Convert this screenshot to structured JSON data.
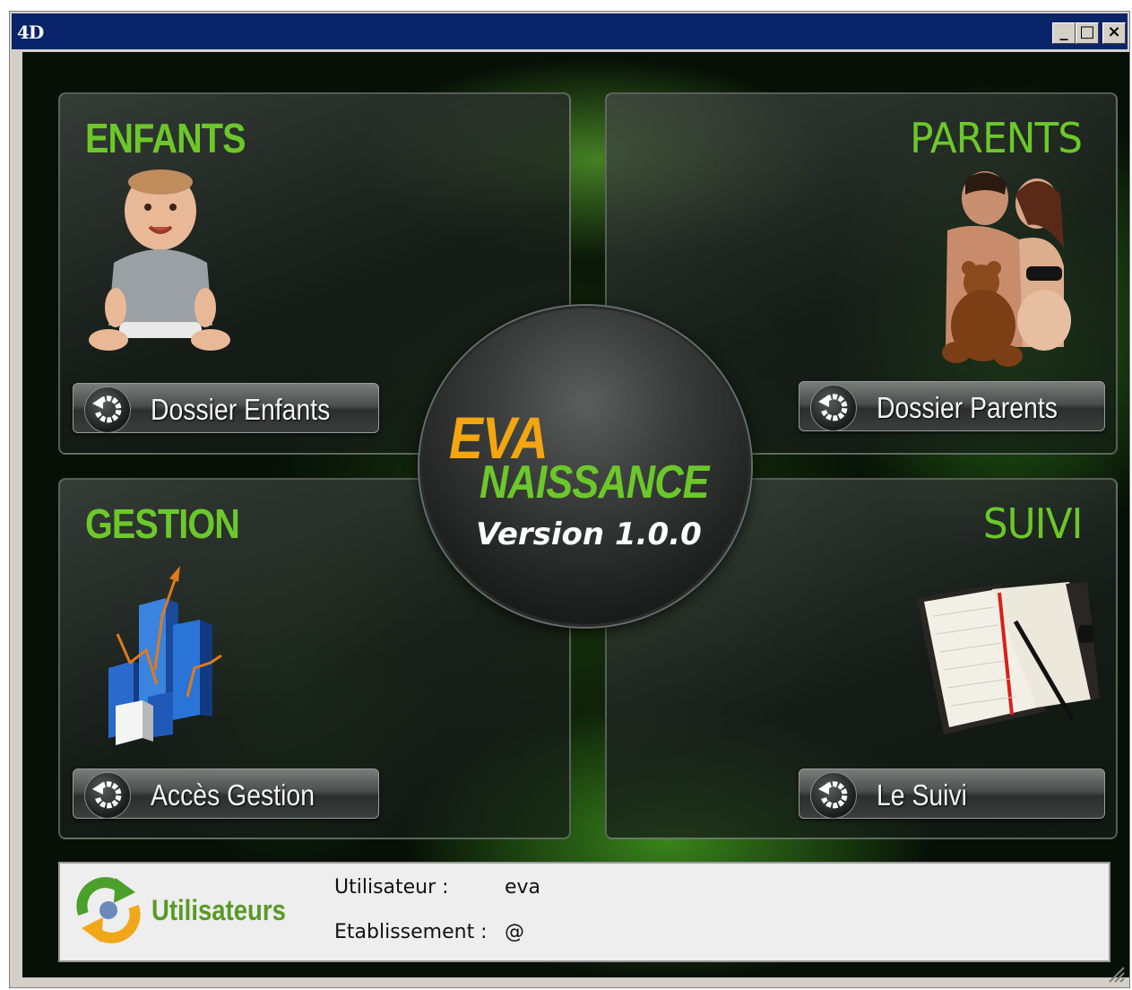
{
  "window": {
    "app_icon_text": "4D",
    "controls": {
      "minimize": "_",
      "maximize": "□",
      "close": "×"
    }
  },
  "panels": {
    "enfants": {
      "title": "ENFANTS",
      "button_label": "Dossier Enfants",
      "image": "baby-photo"
    },
    "parents": {
      "title": "PARENTS",
      "button_label": "Dossier Parents",
      "image": "parents-photo"
    },
    "gestion": {
      "title": "GESTION",
      "button_label": "Accès Gestion",
      "image": "bar-chart-icon"
    },
    "suivi": {
      "title": "SUIVI",
      "button_label": "Le Suivi",
      "image": "notebook-icon"
    }
  },
  "logo": {
    "line1": "EVA",
    "line2": "NAISSANCE",
    "version": "Version 1.0.0"
  },
  "footer": {
    "users_label": "Utilisateurs",
    "user_label": "Utilisateur :",
    "user_value": "eva",
    "etablissement_label": "Etablissement :",
    "etablissement_value": "@"
  },
  "colors": {
    "title_green": "#6cc82a",
    "logo_orange": "#f3a60f",
    "titlebar_blue": "#0a246a"
  }
}
